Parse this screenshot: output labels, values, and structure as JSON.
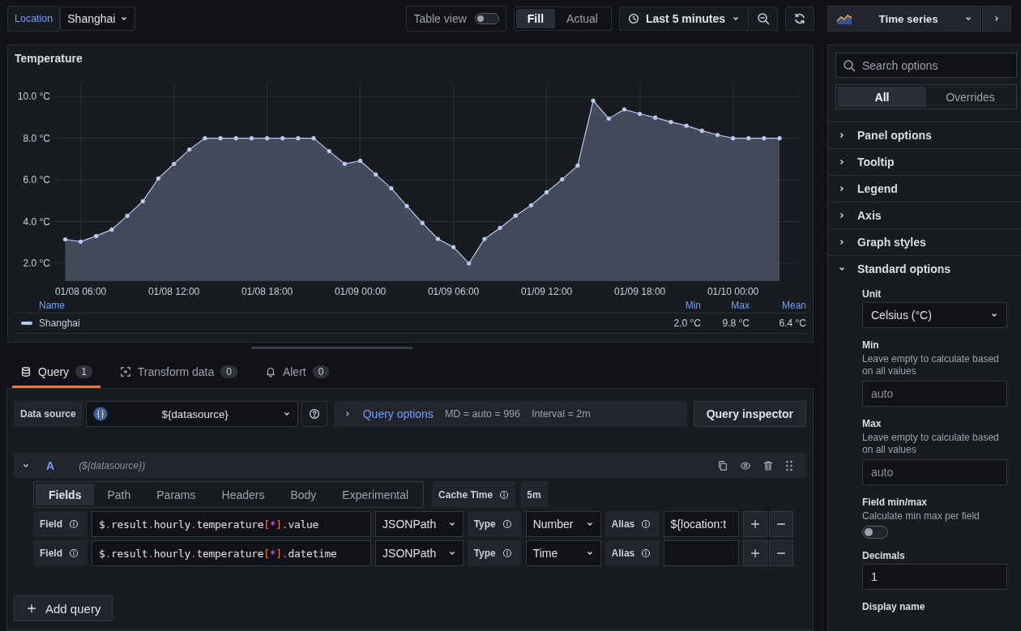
{
  "toolbar": {
    "variable_label": "Location",
    "variable_value": "Shanghai",
    "table_view": {
      "label": "Table view",
      "on": false
    },
    "fill_modes": [
      {
        "label": "Fill",
        "selected": true
      },
      {
        "label": "Actual",
        "selected": false
      }
    ],
    "time_range": "Last 5 minutes"
  },
  "visualization": {
    "name": "Time series"
  },
  "panel": {
    "title": "Temperature",
    "chart_data": {
      "type": "area",
      "categories": [
        null,
        "01/08 06:00",
        null,
        null,
        null,
        null,
        null,
        "01/08 12:00",
        null,
        null,
        null,
        null,
        null,
        "01/08 18:00",
        null,
        null,
        null,
        null,
        null,
        "01/09 00:00",
        null,
        null,
        null,
        null,
        null,
        "01/09 06:00",
        null,
        null,
        null,
        null,
        null,
        "01/09 12:00",
        null,
        null,
        null,
        null,
        null,
        "01/09 18:00",
        null,
        null,
        null,
        null,
        null,
        "01/10 00:00",
        null,
        null,
        null
      ],
      "series": [
        {
          "name": "Shanghai",
          "color": "#b8c9f0",
          "values": [
            3.15,
            3.04,
            3.31,
            3.62,
            4.28,
            4.98,
            6.07,
            6.77,
            7.46,
            8.0,
            8.0,
            8.0,
            8.0,
            8.0,
            8.0,
            8.0,
            8.0,
            7.38,
            6.77,
            6.92,
            6.26,
            5.6,
            4.75,
            3.94,
            3.17,
            2.78,
            2.0,
            3.17,
            3.7,
            4.29,
            4.78,
            5.41,
            6.03,
            6.69,
            9.8,
            8.94,
            9.38,
            9.17,
            8.99,
            8.78,
            8.6,
            8.36,
            8.16,
            8.0,
            8.0,
            8.0,
            8.0
          ]
        }
      ],
      "ylim": [
        1.15,
        10.55
      ],
      "grid": true,
      "yticks": [
        {
          "value": 2,
          "label": "2.0 °C"
        },
        {
          "value": 4,
          "label": "4.0 °C"
        },
        {
          "value": 6,
          "label": "6.0 °C"
        },
        {
          "value": 8,
          "label": "8.0 °C"
        },
        {
          "value": 10,
          "label": "10.0 °C"
        }
      ]
    },
    "legend": {
      "columns": [
        "Name",
        "Min",
        "Max",
        "Mean"
      ],
      "rows": [
        {
          "min": "2.0 °C",
          "max": "9.8 °C",
          "mean": "6.4 °C"
        }
      ]
    }
  },
  "query_tabs": [
    {
      "label": "Query",
      "count": "1",
      "selected": true
    },
    {
      "label": "Transform data",
      "count": "0",
      "selected": false
    },
    {
      "label": "Alert",
      "count": "0",
      "selected": false
    }
  ],
  "query": {
    "datasource_label": "Data source",
    "datasource": "${datasource}",
    "options_label": "Query options",
    "md": "MD = auto = 996",
    "interval": "Interval = 2m",
    "inspector": "Query inspector",
    "row": {
      "letter": "A",
      "source": "(${datasource})",
      "expanded": true,
      "subtabs": [
        {
          "label": "Fields",
          "selected": true
        },
        {
          "label": "Path",
          "selected": false
        },
        {
          "label": "Params",
          "selected": false
        },
        {
          "label": "Headers",
          "selected": false
        },
        {
          "label": "Body",
          "selected": false
        },
        {
          "label": "Experimental",
          "selected": false
        }
      ],
      "cache_label": "Cache Time",
      "cache_value": "5m",
      "fields": [
        {
          "label": "Field",
          "path": "$.result.hourly.temperature[*].value",
          "language": "JSONPath",
          "type_label": "Type",
          "type": "Number",
          "alias_label": "Alias",
          "alias": "${location:t"
        },
        {
          "label": "Field",
          "path": "$.result.hourly.temperature[*].datetime",
          "language": "JSONPath",
          "type_label": "Type",
          "type": "Time",
          "alias_label": "Alias"
        }
      ]
    },
    "add_query": "Add query"
  },
  "options": {
    "search_placeholder": "Search options",
    "tabs": [
      {
        "label": "All",
        "selected": true
      },
      {
        "label": "Overrides",
        "selected": false
      }
    ],
    "sections": [
      {
        "title": "Panel options",
        "expanded": false
      },
      {
        "title": "Tooltip",
        "expanded": false
      },
      {
        "title": "Legend",
        "expanded": false
      },
      {
        "title": "Axis",
        "expanded": false
      },
      {
        "title": "Graph styles",
        "expanded": false
      },
      {
        "title": "Standard options",
        "expanded": true
      }
    ],
    "standard": [
      {
        "kind": "select",
        "label": "Unit",
        "value": "Celsius (°C)"
      },
      {
        "kind": "input",
        "label": "Min",
        "description": "Leave empty to calculate based on all values",
        "placeholder": "auto"
      },
      {
        "kind": "input",
        "label": "Max",
        "description": "Leave empty to calculate based on all values",
        "placeholder": "auto"
      },
      {
        "kind": "switch",
        "label": "Field min/max",
        "description": "Calculate min max per field",
        "on": false
      },
      {
        "kind": "input",
        "label": "Decimals",
        "value": "1"
      },
      {
        "kind": "heading",
        "label": "Display name"
      }
    ]
  }
}
